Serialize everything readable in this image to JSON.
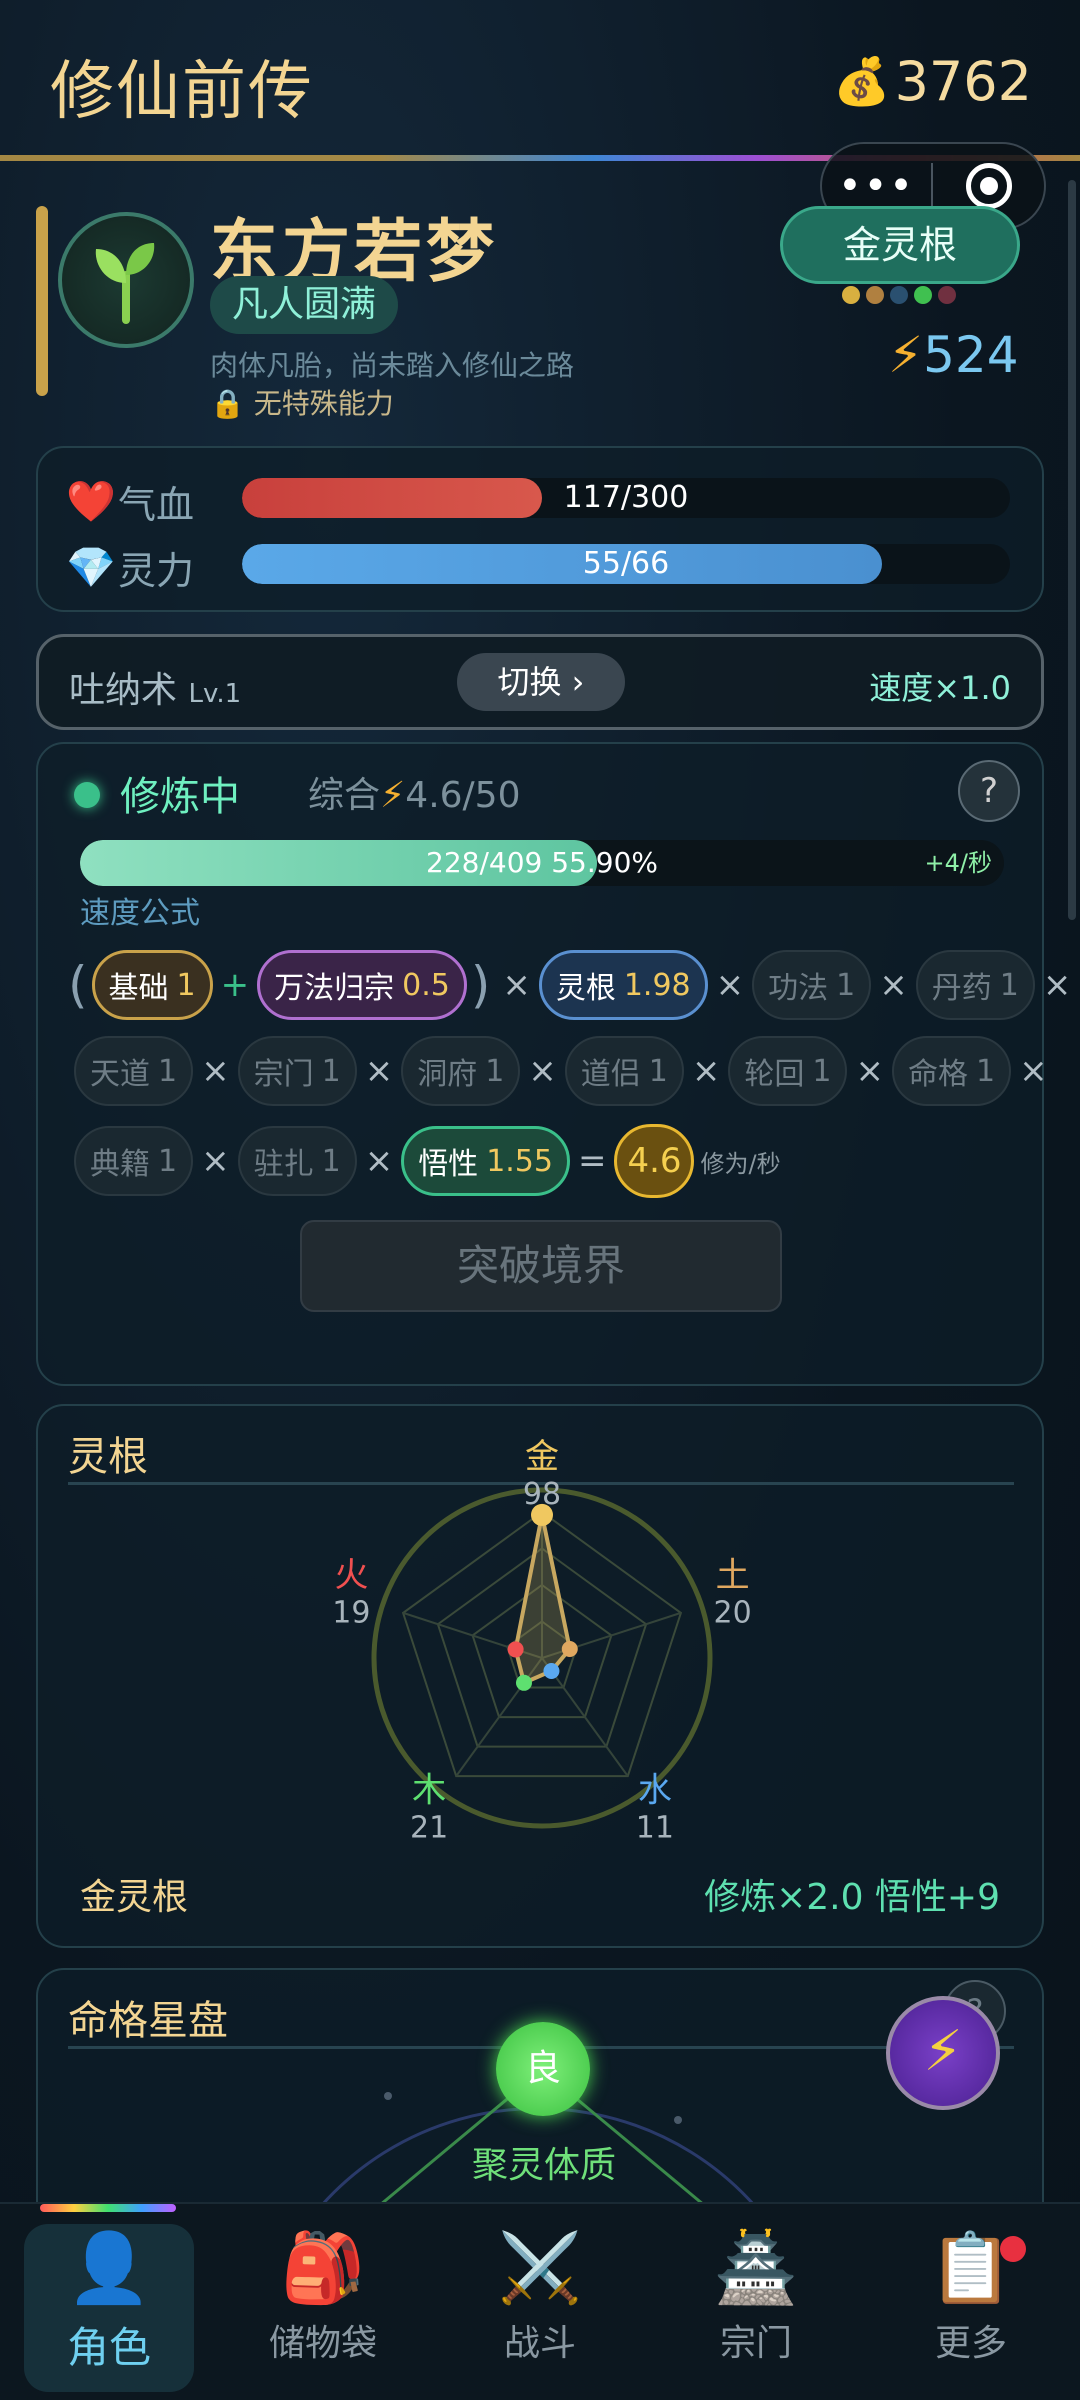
{
  "header": {
    "title": "修仙前传",
    "coins": "3762"
  },
  "profile": {
    "name": "东方若梦",
    "realm": "凡人圆满",
    "description": "肉体凡胎，尚未踏入修仙之路",
    "ability": "无特殊能力",
    "spirit_root_badge": "金灵根",
    "energy": "524"
  },
  "stats": {
    "hp": {
      "label": "气血",
      "value": "117/300",
      "fraction": 0.39
    },
    "mp": {
      "label": "灵力",
      "value": "55/66",
      "fraction": 0.833
    }
  },
  "technique": {
    "name": "吐纳术",
    "level": "Lv.1",
    "switch_label": "切换 ›",
    "speed": "速度×1.0"
  },
  "cultivation": {
    "status": "修炼中",
    "overall_label": "综合",
    "overall_value": "4.6/50",
    "help": "?",
    "progress_text": "228/409  55.90%",
    "progress_fraction": 0.559,
    "rate": "+4/秒",
    "formula_label": "速度公式",
    "factors": {
      "base": {
        "label": "基础",
        "value": "1"
      },
      "wanfa": {
        "label": "万法归宗",
        "value": "0.5"
      },
      "root": {
        "label": "灵根",
        "value": "1.98"
      },
      "gongfa": {
        "label": "功法",
        "value": "1"
      },
      "danyao": {
        "label": "丹药",
        "value": "1"
      },
      "tiandao": {
        "label": "天道",
        "value": "1"
      },
      "zongmen": {
        "label": "宗门",
        "value": "1"
      },
      "dongfu": {
        "label": "洞府",
        "value": "1"
      },
      "daolv": {
        "label": "道侣",
        "value": "1"
      },
      "lunhui": {
        "label": "轮回",
        "value": "1"
      },
      "mingge": {
        "label": "命格",
        "value": "1"
      },
      "dianji": {
        "label": "典籍",
        "value": "1"
      },
      "zhuzha": {
        "label": "驻扎",
        "value": "1"
      },
      "wuxing": {
        "label": "悟性",
        "value": "1.55"
      }
    },
    "result": "4.6",
    "result_unit": "修为/秒",
    "breakthrough_label": "突破境界"
  },
  "spirit_root": {
    "title": "灵根",
    "elements": [
      {
        "name": "金",
        "value": 98,
        "color": "#f0c860"
      },
      {
        "name": "土",
        "value": 20,
        "color": "#e0a860"
      },
      {
        "name": "水",
        "value": 11,
        "color": "#5aa8f0"
      },
      {
        "name": "木",
        "value": 21,
        "color": "#5ee070"
      },
      {
        "name": "火",
        "value": 19,
        "color": "#f05050"
      }
    ],
    "root_name": "金灵根",
    "effect": "修炼×2.0  悟性+9"
  },
  "star_chart": {
    "title": "命格星盘",
    "help": "?",
    "node_grade": "良",
    "node_name": "聚灵体质"
  },
  "tabs": [
    {
      "label": "角色",
      "icon": "person-icon"
    },
    {
      "label": "储物袋",
      "icon": "backpack-icon"
    },
    {
      "label": "战斗",
      "icon": "crossed-swords-icon"
    },
    {
      "label": "宗门",
      "icon": "pagoda-icon"
    },
    {
      "label": "更多",
      "icon": "clipboard-icon"
    }
  ],
  "colors": {
    "gold": "#f3d592",
    "teal": "#3ac08a",
    "hp": "#d04a44",
    "mp": "#4a98d8"
  }
}
